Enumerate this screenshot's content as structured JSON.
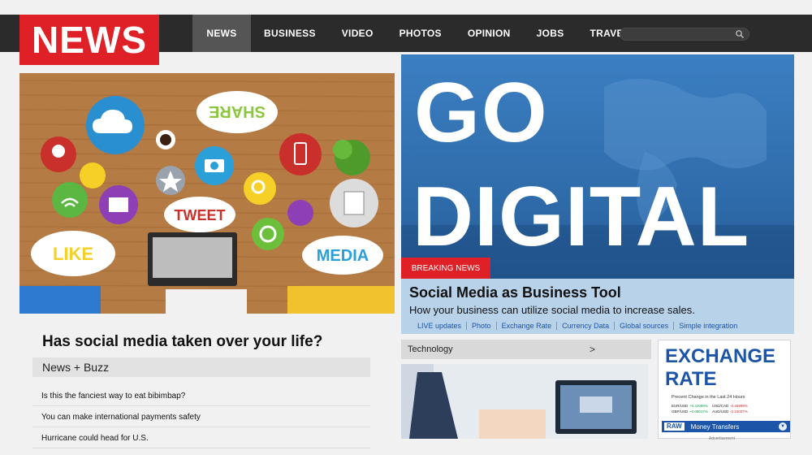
{
  "header": {
    "logo_text": "NEWS",
    "logo_color": "#e02027",
    "nav": [
      "NEWS",
      "BUSINESS",
      "VIDEO",
      "PHOTOS",
      "OPINION",
      "JOBS",
      "TRAVEL"
    ],
    "active_nav": "NEWS",
    "search_icon": "search-icon"
  },
  "hero_left": {
    "bubble_share": "SHARE",
    "bubble_tweet": "TWEET",
    "bubble_like": "LIKE",
    "bubble_media": "MEDIA"
  },
  "left_column": {
    "headline": "Has social media taken over your life?",
    "section_label": "News + Buzz",
    "items": [
      "Is this the fanciest way to eat bibimbap?",
      "You can make international payments safety",
      "Hurricane could head for U.S."
    ]
  },
  "hero_right": {
    "line1": "GO",
    "line2": "DIGITAL",
    "breaking_label": "BREAKING NEWS",
    "story_title": "Social Media as Business Tool",
    "story_subtitle": "How your business can utilize social media to increase sales.",
    "links": [
      "LIVE updates",
      "Photo",
      "Exchange Rate",
      "Currency Data",
      "Global sources",
      "Simple integration"
    ]
  },
  "technology": {
    "label": "Technology",
    "chevron": ">"
  },
  "exchange": {
    "title_line1": "EXCHANGE",
    "title_line2": "RATE",
    "note": "Precent Change in the Last 24 Hours",
    "rows": [
      {
        "p1": "EUR/USD",
        "v1": "+0.32089%",
        "p2": "USD/CAD",
        "v2": "-0.45999%"
      },
      {
        "p1": "GBP/USD",
        "v1": "+0.08017%",
        "p2": "AUD/USD",
        "v2": "-0.24007%"
      }
    ],
    "badge": "RAW",
    "money_transfers": "Money Transfers",
    "advertisement": "Advertisement"
  }
}
